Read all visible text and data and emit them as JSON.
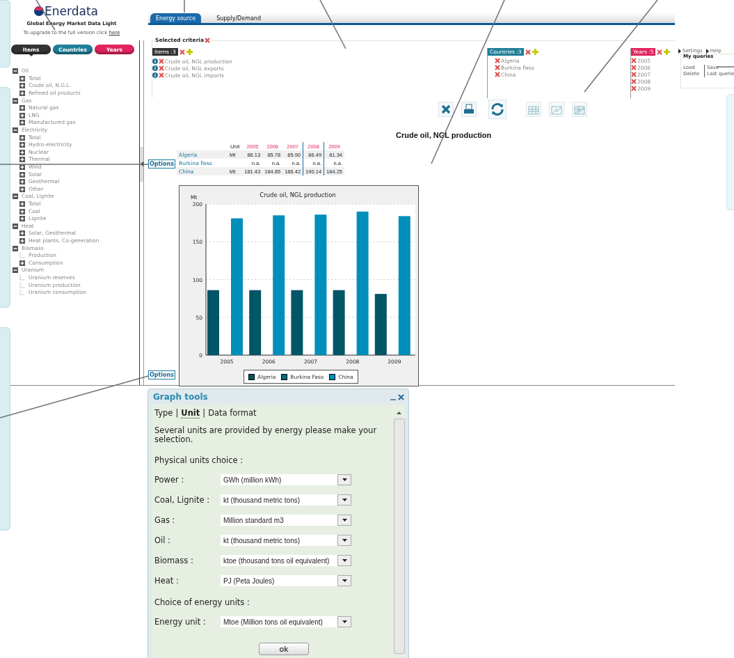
{
  "logo": {
    "name": "Enerdata",
    "subtitle": "Global Energy Market Data Light",
    "upgrade_text": "To upgrade to the full version click",
    "upgrade_link": "here"
  },
  "sidebar_tabs": [
    {
      "label": "Items",
      "selected": true,
      "color": "#333333"
    },
    {
      "label": "Countries",
      "selected": false,
      "color": "#1f7f99"
    },
    {
      "label": "Years",
      "selected": false,
      "color": "#e0245e"
    }
  ],
  "tree": [
    {
      "label": "Oil",
      "expanded": true,
      "children": [
        {
          "label": "Total",
          "kind": "group"
        },
        {
          "label": "Crude oil, N.G.L.",
          "kind": "group"
        },
        {
          "label": "Refined oil products",
          "kind": "group"
        }
      ]
    },
    {
      "label": "Gas",
      "expanded": true,
      "children": [
        {
          "label": "Natural gas",
          "kind": "group"
        },
        {
          "label": "LNG",
          "kind": "group"
        },
        {
          "label": "Manufactured gas",
          "kind": "group"
        }
      ]
    },
    {
      "label": "Electricity",
      "expanded": true,
      "children": [
        {
          "label": "Total",
          "kind": "group"
        },
        {
          "label": "Hydro-electricity",
          "kind": "group"
        },
        {
          "label": "Nuclear",
          "kind": "group"
        },
        {
          "label": "Thermal",
          "kind": "group"
        },
        {
          "label": "Wind",
          "kind": "group"
        },
        {
          "label": "Solar",
          "kind": "group"
        },
        {
          "label": "Geothermal",
          "kind": "group"
        },
        {
          "label": "Other",
          "kind": "group"
        }
      ]
    },
    {
      "label": "Coal, Lignite",
      "expanded": true,
      "children": [
        {
          "label": "Total",
          "kind": "group"
        },
        {
          "label": "Coal",
          "kind": "group"
        },
        {
          "label": "Lignite",
          "kind": "group"
        }
      ]
    },
    {
      "label": "Heat",
      "expanded": true,
      "children": [
        {
          "label": "Solar, Geothermal",
          "kind": "group"
        },
        {
          "label": "Heat plants, Co-generation",
          "kind": "group"
        }
      ]
    },
    {
      "label": "Biomass",
      "expanded": true,
      "children": [
        {
          "label": "Production",
          "kind": "leaf"
        },
        {
          "label": "Consumption",
          "kind": "group"
        }
      ]
    },
    {
      "label": "Uranium",
      "expanded": true,
      "children": [
        {
          "label": "Uranium reserves",
          "kind": "leaf"
        },
        {
          "label": "Uranium production",
          "kind": "leaf"
        },
        {
          "label": "Uranium consumption",
          "kind": "leaf"
        }
      ]
    }
  ],
  "main_tabs": [
    {
      "label": "Energy source",
      "selected": true
    },
    {
      "label": "Supply/Demand",
      "selected": false
    }
  ],
  "criteria": {
    "title": "Selected criteria",
    "groups": [
      {
        "label": "Items :3",
        "color": "#333333",
        "entries": [
          "Crude oil, NGL production",
          "Crude oil, NGL exports",
          "Crude oil, NGL imports"
        ],
        "info": true
      },
      {
        "label": "Countries :3",
        "color": "#1f7f99",
        "entries": [
          "Algeria",
          "Burkina Faso",
          "China"
        ],
        "info": false
      },
      {
        "label": "Years :5",
        "color": "#e0245e",
        "entries": [
          "2005",
          "2006",
          "2007",
          "2008",
          "2009"
        ],
        "info": false
      }
    ]
  },
  "queries": {
    "links": [
      "Settings",
      "Help"
    ],
    "title": "My queries",
    "actions": [
      "Load",
      "Save",
      "Delete",
      "Last querie"
    ]
  },
  "report": {
    "title": "Crude oil, NGL production",
    "options_label": [
      "Options",
      "Options"
    ],
    "table": {
      "unit_header": "Unit",
      "years": [
        "2005",
        "2006",
        "2007",
        "2008",
        "2009"
      ],
      "rows": [
        {
          "country": "Algeria",
          "unit": "Mt",
          "values": [
            "86.13",
            "85.78",
            "85.90",
            "86.49",
            "81.34"
          ]
        },
        {
          "country": "Burkina Faso",
          "unit": "",
          "values": [
            "n.a.",
            "n.a.",
            "n.a.",
            "n.a.",
            "n.a."
          ]
        },
        {
          "country": "China",
          "unit": "Mt",
          "values": [
            "181.43",
            "184.85",
            "186.42",
            "190.14",
            "184.25"
          ]
        }
      ]
    },
    "chart_data": {
      "type": "bar",
      "title": "Crude oil, NGL production",
      "ylabel": "Mt",
      "categories": [
        "2005",
        "2006",
        "2007",
        "2008",
        "2009"
      ],
      "series": [
        {
          "name": "Algeria",
          "color": "#005566",
          "values": [
            86,
            86,
            86,
            86,
            81
          ]
        },
        {
          "name": "Burkina Faso",
          "color": "#006b80",
          "values": [
            null,
            null,
            null,
            null,
            null
          ]
        },
        {
          "name": "China",
          "color": "#008fbb",
          "values": [
            181,
            185,
            186,
            190,
            184
          ]
        }
      ],
      "ylim": [
        0,
        200
      ],
      "yticks": [
        0,
        50,
        100,
        150,
        200
      ],
      "grid": true,
      "legend": true
    }
  },
  "graph_tools": {
    "title": "Graph tools",
    "tabs": [
      {
        "label": "Type",
        "selected": false
      },
      {
        "label": "Unit",
        "selected": true
      },
      {
        "label": "Data format",
        "selected": false
      }
    ],
    "tab_separators": [
      "|",
      "|"
    ],
    "intro": "Several units are provided by energy please make your selection.",
    "sections": [
      {
        "heading": "Physical units choice :",
        "fields": [
          {
            "label": "Power :",
            "value": "GWh (million kWh)"
          },
          {
            "label": "Coal, Lignite :",
            "value": "kt (thousand metric tons)"
          },
          {
            "label": "Gas :",
            "value": "Million standard m3"
          },
          {
            "label": "Oil :",
            "value": "kt (thousand metric tons)"
          },
          {
            "label": "Biomass :",
            "value": "ktoe (thousand tons oil equivalent)"
          },
          {
            "label": "Heat :",
            "value": "PJ (Peta Joules)"
          }
        ]
      },
      {
        "heading": "Choice of energy units :",
        "fields": [
          {
            "label": "Energy unit :",
            "value": "Mtoe (Million tons oil equivalent)"
          }
        ]
      }
    ],
    "ok_label": "ok"
  }
}
